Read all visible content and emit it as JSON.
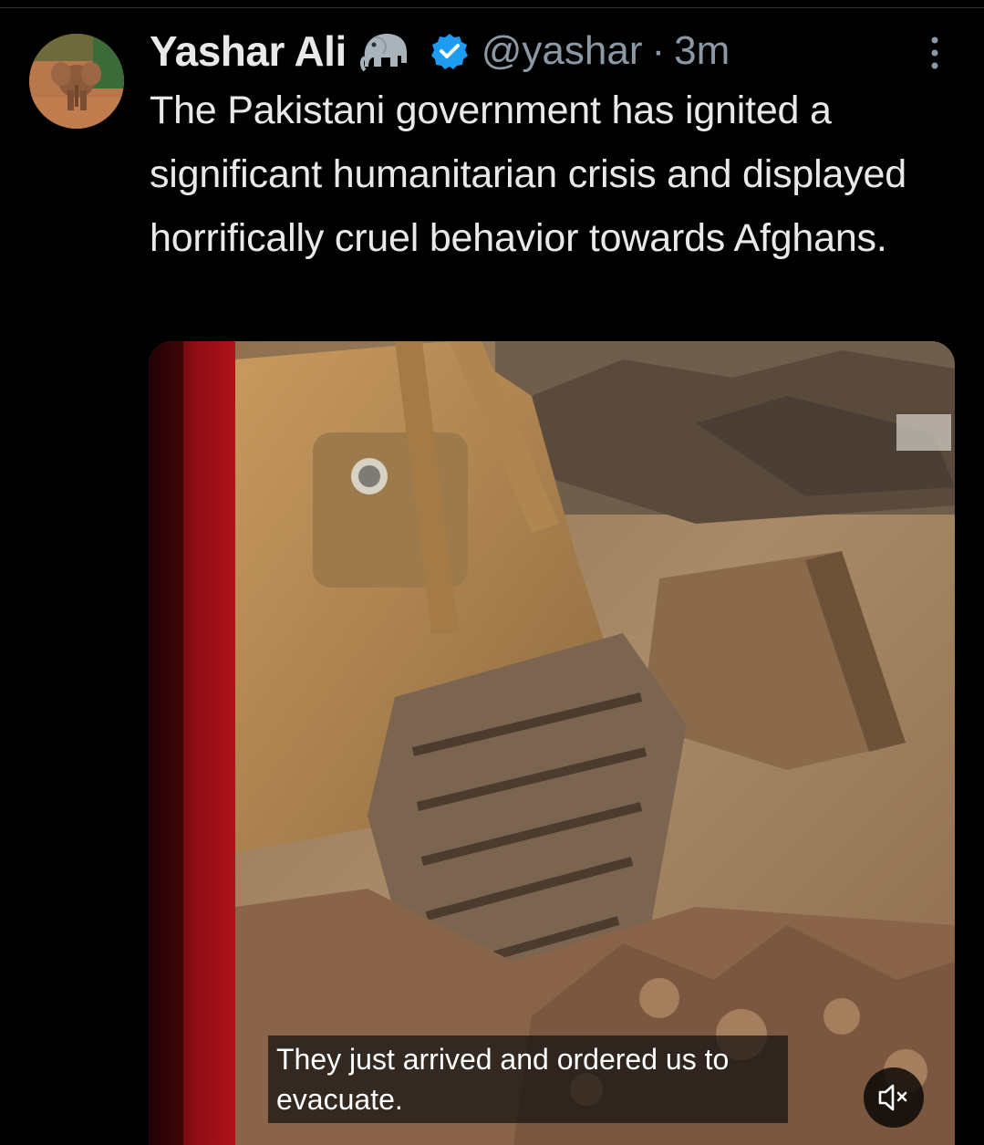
{
  "tweet": {
    "display_name": "Yashar Ali",
    "name_emoji_icon": "elephant-icon",
    "verified_icon": "verified-badge-icon",
    "handle": "@yashar",
    "separator": "·",
    "time": "3m",
    "more_icon": "more-vertical-icon",
    "text": "The Pakistani government has ignited a significant humanitarian crisis and displayed horrifically cruel behavior towards Afghans.",
    "media": {
      "type": "video",
      "caption": "They just arrived and ordered us to evacuate.",
      "mute_icon": "speaker-muted-icon"
    }
  },
  "colors": {
    "background": "#000000",
    "primary_text": "#e7e9ea",
    "secondary_text": "#8b98a5",
    "verified_blue": "#1d9bf0"
  }
}
